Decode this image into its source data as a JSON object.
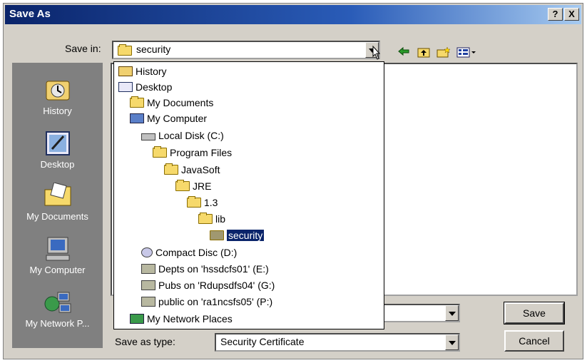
{
  "window": {
    "title": "Save As",
    "help_btn": "?",
    "close_btn": "X"
  },
  "save_in": {
    "label": "Save in:",
    "value": "security"
  },
  "toolbar": {
    "back_icon": "back-arrow-icon",
    "up_icon": "up-folder-icon",
    "new_folder_icon": "new-folder-icon",
    "views_icon": "views-menu-icon"
  },
  "sidebar": {
    "items": [
      {
        "label": "History",
        "icon": "history-icon"
      },
      {
        "label": "Desktop",
        "icon": "desktop-icon"
      },
      {
        "label": "My Documents",
        "icon": "my-documents-icon"
      },
      {
        "label": "My Computer",
        "icon": "my-computer-icon"
      },
      {
        "label": "My Network P...",
        "icon": "network-places-icon"
      }
    ]
  },
  "dropdown_items": [
    {
      "label": "History",
      "icon": "history-icon"
    },
    {
      "label": "Desktop",
      "icon": "desktop-icon"
    },
    {
      "label": "My Documents",
      "icon": "my-documents-icon"
    },
    {
      "label": "My Computer",
      "icon": "my-computer-icon"
    },
    {
      "label": "Local Disk (C:)",
      "icon": "drive-icon"
    },
    {
      "label": "Program Files",
      "icon": "folder-icon"
    },
    {
      "label": "JavaSoft",
      "icon": "folder-icon"
    },
    {
      "label": "JRE",
      "icon": "folder-icon"
    },
    {
      "label": "1.3",
      "icon": "folder-icon"
    },
    {
      "label": "lib",
      "icon": "folder-icon"
    },
    {
      "label": "security",
      "icon": "open-folder-icon",
      "selected": true
    },
    {
      "label": "Compact Disc (D:)",
      "icon": "cd-drive-icon"
    },
    {
      "label": "Depts on 'hssdcfs01' (E:)",
      "icon": "network-drive-icon"
    },
    {
      "label": "Pubs on 'Rdupsdfs04' (G:)",
      "icon": "network-drive-icon"
    },
    {
      "label": "public on 'ra1ncsfs05' (P:)",
      "icon": "network-drive-icon"
    },
    {
      "label": "My Network Places",
      "icon": "network-places-icon"
    }
  ],
  "file_name": {
    "value": ""
  },
  "save_as_type": {
    "label": "Save as type:",
    "value": "Security Certificate"
  },
  "buttons": {
    "save": "Save",
    "cancel": "Cancel"
  },
  "colors": {
    "title_start": "#0a246a",
    "title_end": "#a6caf0",
    "face": "#d4d0c8",
    "selection": "#0a246a",
    "sidebar": "#808080"
  }
}
